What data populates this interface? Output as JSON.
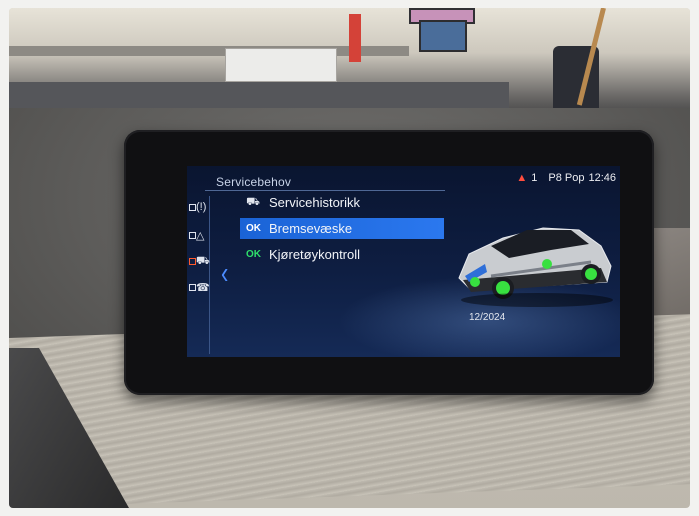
{
  "screen": {
    "title": "Servicebehov",
    "status": {
      "warning_count": "1",
      "radio": "P8 Pop",
      "clock": "12:46"
    },
    "menu_items": [
      {
        "tag": "",
        "label": "Servicehistorikk",
        "icon": "car-service-icon"
      },
      {
        "tag": "OK",
        "label": "Bremsevæske",
        "icon": ""
      },
      {
        "tag": "OK",
        "label": "Kjøretøykontroll",
        "icon": ""
      }
    ],
    "date": "12/2024"
  },
  "colors": {
    "screen_bg": "#0e1e42",
    "selection": "#2b78ef",
    "ok_green": "#2fe06b",
    "warning_red": "#ff4d3e",
    "highlight_wheel": "#38e040"
  }
}
